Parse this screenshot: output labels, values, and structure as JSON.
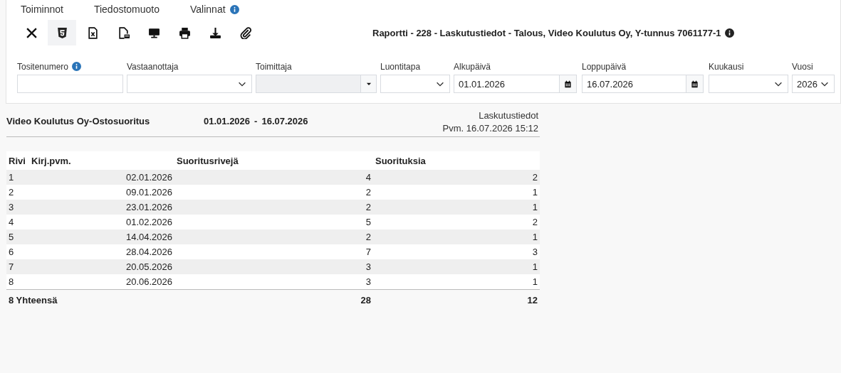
{
  "menu": [
    {
      "label": "Toiminnot",
      "info": false
    },
    {
      "label": "Tiedostomuoto",
      "info": false
    },
    {
      "label": "Valinnat",
      "info": true
    }
  ],
  "toolbar": [
    {
      "kind": "close",
      "selected": false
    },
    {
      "kind": "html",
      "selected": true
    },
    {
      "kind": "excel",
      "selected": false
    },
    {
      "kind": "pdf",
      "selected": false
    },
    {
      "kind": "screen",
      "selected": false
    },
    {
      "kind": "print",
      "selected": false
    },
    {
      "kind": "download",
      "selected": false
    },
    {
      "kind": "attach",
      "selected": false
    }
  ],
  "report_title": "Raportti - 228 - Laskutustiedot - Talous, Video Koulutus Oy, Y-tunnus 7061177-1",
  "filters": [
    {
      "label": "Tositenumero",
      "info": true,
      "kind": "text",
      "disabled": false
    },
    {
      "label": "Vastaanottaja",
      "info": false,
      "kind": "select",
      "disabled": false
    },
    {
      "label": "Toimittaja",
      "info": false,
      "kind": "combo",
      "disabled": true
    },
    {
      "label": "Luontitapa",
      "info": false,
      "kind": "select",
      "disabled": false
    },
    {
      "label": "Alkupäivä",
      "info": false,
      "kind": "date",
      "disabled": false,
      "value": "01.01.2026"
    },
    {
      "label": "Loppupäivä",
      "info": false,
      "kind": "date",
      "disabled": false,
      "value": "16.07.2026"
    },
    {
      "label": "Kuukausi",
      "info": false,
      "kind": "select",
      "disabled": false
    },
    {
      "label": "Vuosi",
      "info": false,
      "kind": "select",
      "disabled": false,
      "value": "2026"
    }
  ],
  "report": {
    "name": "Video Koulutus Oy-Ostosuoritus",
    "start": "01.01.2026",
    "separator": "-",
    "end": "16.07.2026",
    "type": "Laskutustiedot",
    "printed": "Pvm. 16.07.2026 15:12"
  },
  "table": {
    "columns": [
      "Rivi",
      "Kirj.pvm.",
      "Suoritusrivejä",
      "Suorituksia"
    ],
    "rows": [
      [
        "1",
        "02.01.2026",
        "4",
        "2"
      ],
      [
        "2",
        "09.01.2026",
        "2",
        "1"
      ],
      [
        "3",
        "23.01.2026",
        "2",
        "1"
      ],
      [
        "4",
        "01.02.2026",
        "5",
        "2"
      ],
      [
        "5",
        "14.04.2026",
        "2",
        "1"
      ],
      [
        "6",
        "28.04.2026",
        "7",
        "3"
      ],
      [
        "7",
        "20.05.2026",
        "3",
        "1"
      ],
      [
        "8",
        "20.06.2026",
        "3",
        "1"
      ]
    ],
    "total": {
      "label": "8 Yhteensä",
      "rows": "28",
      "payments": "12"
    }
  }
}
